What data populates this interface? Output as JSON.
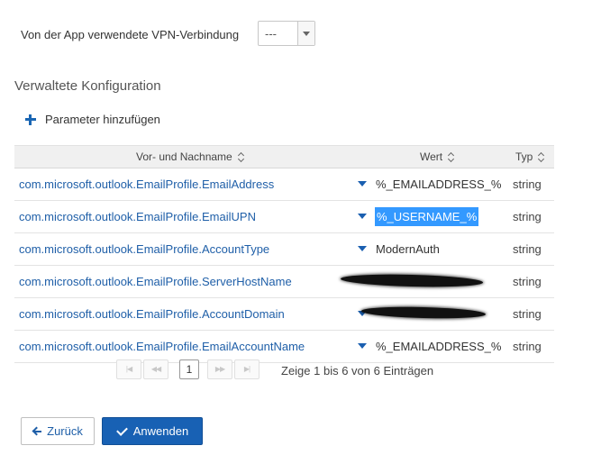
{
  "vpn": {
    "label": "Von der App verwendete VPN-Verbindung",
    "selected": "---"
  },
  "section": {
    "title": "Verwaltete Konfiguration"
  },
  "add_parameter": {
    "label": "Parameter hinzufügen"
  },
  "table": {
    "columns": {
      "name": "Vor- und Nachname",
      "value": "Wert",
      "type": "Typ"
    },
    "rows": [
      {
        "name": "com.microsoft.outlook.EmailProfile.EmailAddress",
        "value": "%_EMAILADDRESS_%",
        "type": "string",
        "value_selected": false,
        "redacted": false
      },
      {
        "name": "com.microsoft.outlook.EmailProfile.EmailUPN",
        "value": "%_USERNAME_%",
        "type": "string",
        "value_selected": true,
        "redacted": false
      },
      {
        "name": "com.microsoft.outlook.EmailProfile.AccountType",
        "value": "ModernAuth",
        "type": "string",
        "value_selected": false,
        "redacted": false
      },
      {
        "name": "com.microsoft.outlook.EmailProfile.ServerHostName",
        "value": "",
        "type": "string",
        "value_selected": false,
        "redacted": true
      },
      {
        "name": "com.microsoft.outlook.EmailProfile.AccountDomain",
        "value": "",
        "type": "string",
        "value_selected": false,
        "redacted": true
      },
      {
        "name": "com.microsoft.outlook.EmailProfile.EmailAccountName",
        "value": "%_EMAILADDRESS_%",
        "type": "string",
        "value_selected": false,
        "redacted": false
      }
    ]
  },
  "pagination": {
    "current_page": "1",
    "info": "Zeige 1 bis 6 von 6 Einträgen"
  },
  "buttons": {
    "back": "Zurück",
    "apply": "Anwenden"
  },
  "colors": {
    "accent": "#1861b4",
    "link": "#1f5fa8",
    "selection": "#3399ff"
  }
}
